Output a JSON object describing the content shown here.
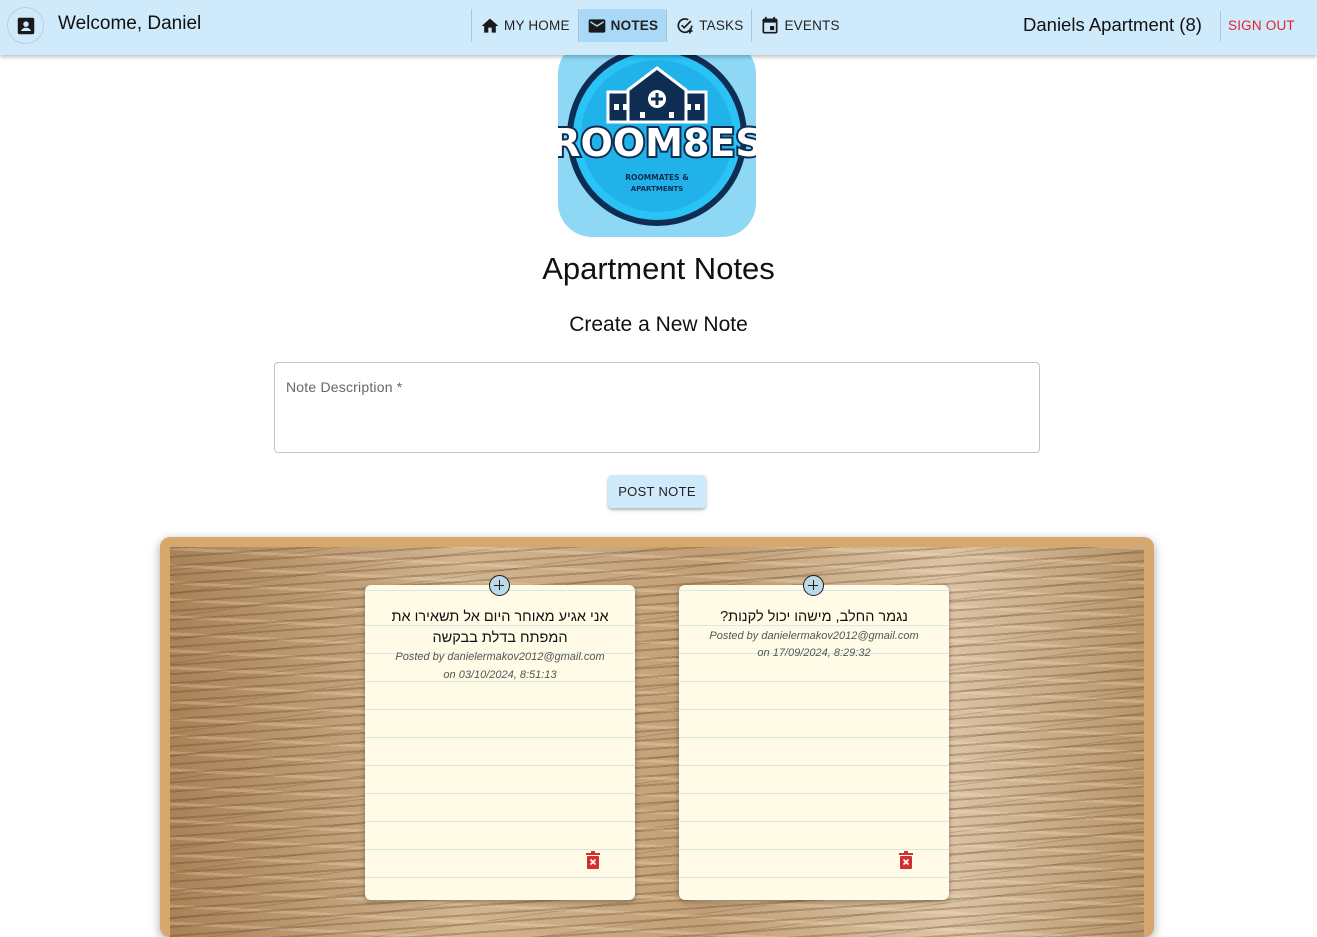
{
  "header": {
    "welcome": "Welcome, Daniel",
    "apartment": "Daniels Apartment (8)",
    "signout": "SIGN OUT",
    "nav": [
      {
        "label": "MY HOME",
        "icon": "home-icon"
      },
      {
        "label": "NOTES",
        "icon": "mail-icon",
        "active": true
      },
      {
        "label": "TASKS",
        "icon": "task-check-icon"
      },
      {
        "label": "EVENTS",
        "icon": "calendar-icon"
      }
    ]
  },
  "logo": {
    "brand": "ROOM8ES",
    "tagline_1": "ROOMMATES &",
    "tagline_2": "APARTMENTS"
  },
  "page": {
    "title": "Apartment Notes",
    "subtitle": "Create a New Note"
  },
  "form": {
    "label": "Note Description *",
    "value": "",
    "post_label": "POST NOTE"
  },
  "notes": [
    {
      "text": "אני אגיע מאוחר היום אל תשאירו את המפתח בדלת בבקשה",
      "posted_by": "Posted by danielermakov2012@gmail.com",
      "posted_on": "on 03/10/2024, 8:51:13"
    },
    {
      "text": "נגמר החלב, מישהו יכול לקנות?",
      "posted_by": "Posted by danielermakov2012@gmail.com",
      "posted_on": "on 17/09/2024, 8:29:32"
    }
  ],
  "colors": {
    "header_bg": "#cfeafb",
    "active_nav": "#a9d9f7",
    "signout": "#e0242c",
    "sticky_bg": "#fffbe6",
    "board_frame": "#d6a86e",
    "trash": "#d32f2f"
  }
}
